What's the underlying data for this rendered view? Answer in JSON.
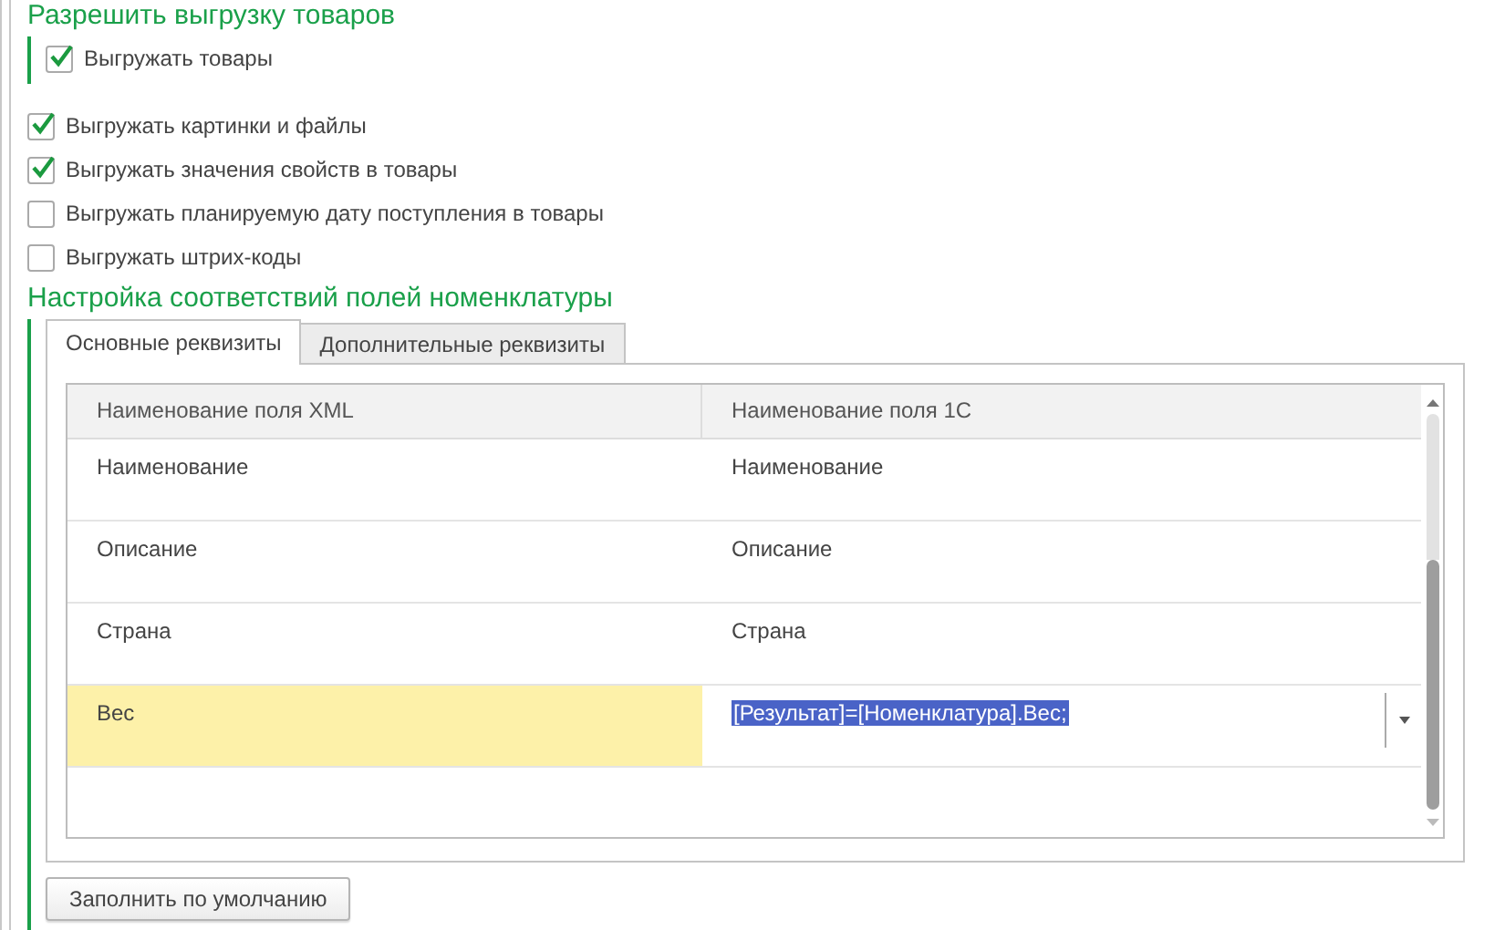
{
  "export_section": {
    "title": "Разрешить выгрузку товаров",
    "main_option": {
      "label": "Выгружать товары",
      "checked": true
    }
  },
  "options": [
    {
      "label": "Выгружать картинки и файлы",
      "checked": true
    },
    {
      "label": "Выгружать значения свойств в товары",
      "checked": true
    },
    {
      "label": "Выгружать планируемую дату поступления в товары",
      "checked": false
    },
    {
      "label": "Выгружать штрих-коды",
      "checked": false
    }
  ],
  "mapping": {
    "title": "Настройка соответствий полей номенклатуры",
    "tabs": [
      {
        "label": "Основные реквизиты",
        "selected": true
      },
      {
        "label": "Дополнительные реквизиты",
        "selected": false
      }
    ],
    "table": {
      "columns": [
        "Наименование поля XML",
        "Наименование поля 1С"
      ],
      "rows": [
        {
          "xml_field": "Наименование",
          "field_1c": "Наименование",
          "selected": false,
          "editing": false
        },
        {
          "xml_field": "Описание",
          "field_1c": "Описание",
          "selected": false,
          "editing": false
        },
        {
          "xml_field": "Страна",
          "field_1c": "Страна",
          "selected": false,
          "editing": false
        },
        {
          "xml_field": "Вес",
          "field_1c": "[Результат]=[Номенклатура].Вес;",
          "selected": true,
          "editing": true
        }
      ]
    },
    "fill_default_button": "Заполнить по умолчанию"
  }
}
